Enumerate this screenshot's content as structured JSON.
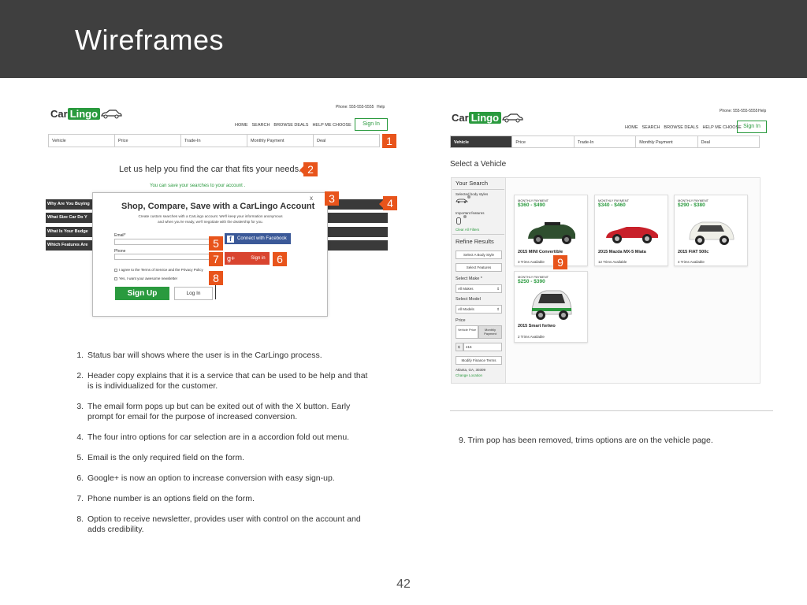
{
  "slide": {
    "title": "Wireframes",
    "page_number": "42"
  },
  "left": {
    "topbar": {
      "phone": "Phone: 555-555-5555",
      "help": "Help"
    },
    "logo": {
      "car": "Car",
      "lingo": "Lingo"
    },
    "nav": [
      "HOME",
      "SEARCH",
      "BROWSE DEALS",
      "HELP ME CHOOSE"
    ],
    "signin": "Sign In",
    "steps": [
      "Vehicle",
      "Price",
      "Trade-In",
      "Monthly Payment",
      "Deal"
    ],
    "headline": "Let us help you find the car that fits your needs.",
    "save_note": "You can save your searches to your account .",
    "accordion": [
      "Why Are You Buying",
      "What Size Car Do Y",
      "What Is Your Budge",
      "Which Features Are"
    ],
    "modal": {
      "close": "x",
      "title": "Shop, Compare, Save with a CarLingo Account",
      "subtitle_1": "Create custom searches with a CarLingo account. We'll keep your information anonymous",
      "subtitle_2": "and when you're ready, we'll negotiate with the dealership for you.",
      "email_label": "Email*",
      "phone_label": "Phone",
      "facebook": "Connect with Facebook",
      "gplus_icon": "g+",
      "gplus": "Sign in",
      "terms": "I agree to the Terms of Service and the Privacy Policy",
      "newsletter": "Yes, I want your awesome newsletter",
      "signup": "Sign Up",
      "login": "Log In"
    }
  },
  "markers": [
    "1",
    "2",
    "3",
    "4",
    "5",
    "6",
    "7",
    "8",
    "9"
  ],
  "notes": [
    "Status bar will shows where the user is in the CarLingo process.",
    "Header copy explains that it is a service that can be used to be help and that is is individualized for the customer.",
    "The email form pops up but can be exited out of with the X button. Early prompt for email for the purpose of increased conversion.",
    "The four intro options for car selection are in a accordion fold out menu.",
    "Email is the only required field on the form.",
    "Google+ is now an option to increase conversion with easy sign-up.",
    "Phone number is an options field on the form.",
    "Option to receive newsletter, provides user with control on the account and adds credibility."
  ],
  "right": {
    "topbar": {
      "phone": "Phone: 555-555-5555",
      "help": "Help"
    },
    "logo": {
      "car": "Car",
      "lingo": "Lingo"
    },
    "nav": [
      "HOME",
      "SEARCH",
      "BROWSE DEALS",
      "HELP ME CHOOSE"
    ],
    "signin": "Sign In",
    "steps": [
      "Vehicle",
      "Price",
      "Trade-In",
      "Monthly Payment",
      "Deal"
    ],
    "page_title": "Select a Vehicle",
    "sidebar": {
      "your_search": "Your Search",
      "body_styles": "Selected body styles",
      "features": "Important features",
      "clear": "Clear All Filters",
      "refine": "Refine Results",
      "body_btn": "Select A Body Style",
      "feat_btn": "Select Features",
      "make_label": "Select Make *",
      "make_value": "All Makes",
      "model_label": "Select Model",
      "model_value": "All Models",
      "price_label": "Price",
      "price_tab_1": "Vehicle Price",
      "price_tab_2": "Monthly Payment",
      "dollar": "$",
      "amount": "415",
      "finance_btn": "Modify Finance Terms",
      "location": "Atlanta, GA, 30309",
      "change_location": "Change Location"
    },
    "cars": [
      {
        "mp": "MONTHLY PAYMENT",
        "price": "$360 - $490",
        "name": "2015 MINI Convertible",
        "trims": "3 Trims Available",
        "color": "#2f4f2f"
      },
      {
        "mp": "MONTHLY PAYMENT",
        "price": "$340 - $460",
        "name": "2015 Mazda MX-5 Miata",
        "trims": "12 Trims Available",
        "color": "#c8202a"
      },
      {
        "mp": "MONTHLY PAYMENT",
        "price": "$290 - $380",
        "name": "2015 FIAT 500c",
        "trims": "4 Trims Available",
        "color": "#efefe8"
      },
      {
        "mp": "MONTHLY PAYMENT",
        "price": "$250 - $390",
        "name": "2015 Smart fortwo",
        "trims": "2 Trims Available",
        "color": "#e8e8e8"
      }
    ],
    "note": "9. Trim pop has been removed, trims options are on the vehicle page."
  },
  "colors": {
    "header": "#3f3f3f",
    "brand_green": "#2a9a3e",
    "marker": "#e8541b"
  }
}
